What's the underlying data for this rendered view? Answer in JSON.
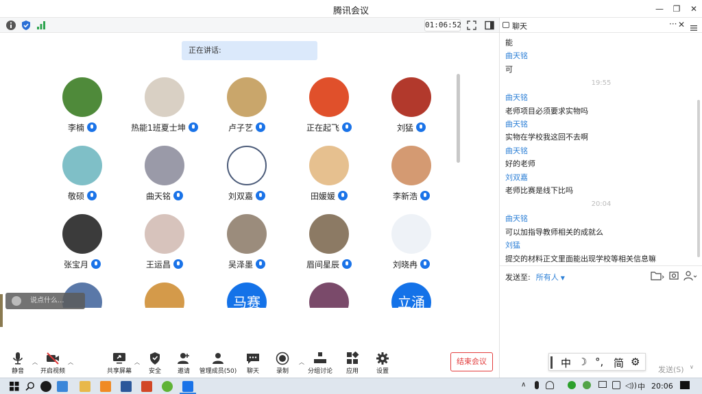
{
  "window": {
    "title": "腾讯会议",
    "minimize": "—",
    "restore": "❐",
    "close": "✕"
  },
  "toolbar": {
    "timer": "01:06:52"
  },
  "speaking": {
    "label": "正在讲话:"
  },
  "participants": [
    {
      "name": "李楠",
      "avatar_color": "#4f8a3a",
      "avatar_text": ""
    },
    {
      "name": "热能1班夏士坤",
      "avatar_color": "#d9d0c4",
      "avatar_text": ""
    },
    {
      "name": "卢子艺",
      "avatar_color": "#c9a66b",
      "avatar_text": ""
    },
    {
      "name": "正在起飞",
      "avatar_color": "#e0502b",
      "avatar_text": ""
    },
    {
      "name": "刘猛",
      "avatar_color": "#b2392c",
      "avatar_text": ""
    },
    {
      "name": "敬硕",
      "avatar_color": "#7fbfc7",
      "avatar_text": ""
    },
    {
      "name": "曲天铭",
      "avatar_color": "#9a9aa8",
      "avatar_text": ""
    },
    {
      "name": "刘双嘉",
      "avatar_color": "#ffffff",
      "avatar_text": ""
    },
    {
      "name": "田媛媛",
      "avatar_color": "#e6c08f",
      "avatar_text": ""
    },
    {
      "name": "李新浩",
      "avatar_color": "#d49a72",
      "avatar_text": ""
    },
    {
      "name": "张宝月",
      "avatar_color": "#3b3b3b",
      "avatar_text": ""
    },
    {
      "name": "王运昌",
      "avatar_color": "#d7c3bc",
      "avatar_text": ""
    },
    {
      "name": "吴泽墨",
      "avatar_color": "#9b8c7c",
      "avatar_text": ""
    },
    {
      "name": "眉间星辰",
      "avatar_color": "#8c7a64",
      "avatar_text": ""
    },
    {
      "name": "刘晓冉",
      "avatar_color": "#eef2f7",
      "avatar_text": ""
    },
    {
      "name": "",
      "avatar_color": "#5a78a8",
      "avatar_text": ""
    },
    {
      "name": "",
      "avatar_color": "#d49a4a",
      "avatar_text": ""
    },
    {
      "name": "",
      "avatar_color": "#1472e8",
      "avatar_text": "马赛"
    },
    {
      "name": "",
      "avatar_color": "#7a4a6a",
      "avatar_text": ""
    },
    {
      "name": "",
      "avatar_color": "#1472e8",
      "avatar_text": "立涌"
    }
  ],
  "floating_chat": {
    "placeholder": "说点什么..."
  },
  "controls": {
    "mute": "静音",
    "video": "开启视频",
    "share": "共享屏幕",
    "security": "安全",
    "invite": "邀请",
    "members": "管理成员(50)",
    "chat": "聊天",
    "record": "录制",
    "breakout": "分组讨论",
    "apps": "应用",
    "settings": "设置",
    "end": "结束会议"
  },
  "chat": {
    "title": "聊天",
    "more": "···",
    "close": "✕",
    "messages": [
      {
        "kind": "text",
        "text": "能"
      },
      {
        "kind": "sender",
        "text": "曲天铭"
      },
      {
        "kind": "text",
        "text": "可"
      },
      {
        "kind": "time",
        "text": "19:55"
      },
      {
        "kind": "sender",
        "text": "曲天铭"
      },
      {
        "kind": "text",
        "text": "老师项目必须要求实物吗"
      },
      {
        "kind": "sender",
        "text": "曲天铭"
      },
      {
        "kind": "text",
        "text": "实物在学校我这回不去啊"
      },
      {
        "kind": "sender",
        "text": "曲天铭"
      },
      {
        "kind": "text",
        "text": "好的老师"
      },
      {
        "kind": "sender",
        "text": "刘双嘉"
      },
      {
        "kind": "text",
        "text": "老师比赛是线下比吗"
      },
      {
        "kind": "time",
        "text": "20:04"
      },
      {
        "kind": "sender",
        "text": "曲天铭"
      },
      {
        "kind": "text",
        "text": "可以加指导教师相关的成就么"
      },
      {
        "kind": "sender",
        "text": "刘猛"
      },
      {
        "kind": "text",
        "text": "提交的材料正文里面能出现学校等相关信息嘛"
      }
    ],
    "send_to_label": "发送至:",
    "send_to_target": "所有人",
    "send_button": "发送(S)"
  },
  "ime": {
    "mode": "中",
    "moon": "☽",
    "punct": "°,",
    "script": "简",
    "gear": "⚙"
  },
  "taskbar": {
    "tray_lang": "中",
    "clock": "20:06"
  },
  "colors": {
    "accent": "#1a73e8",
    "sender": "#2c7fd6",
    "end_red": "#e23b3b"
  }
}
